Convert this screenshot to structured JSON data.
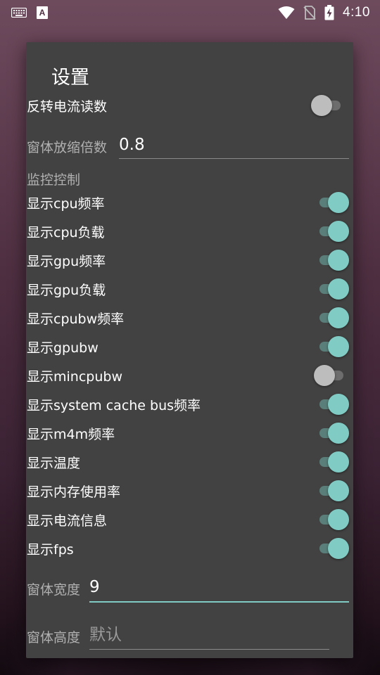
{
  "status_bar": {
    "time": "4:10",
    "left_icons": [
      "keyboard-icon",
      "font-app-icon"
    ],
    "right_icons": [
      "wifi-icon",
      "no-sim-icon",
      "battery-charging-icon"
    ]
  },
  "dialog": {
    "title": "设置",
    "invert_current": {
      "label": "反转电流读数",
      "on": false
    },
    "scale": {
      "label": "窗体放缩倍数",
      "value": "0.8"
    },
    "monitor_header": "监控控制",
    "switches": [
      {
        "label": "显示cpu频率",
        "on": true
      },
      {
        "label": "显示cpu负载",
        "on": true
      },
      {
        "label": "显示gpu频率",
        "on": true
      },
      {
        "label": "显示gpu负载",
        "on": true
      },
      {
        "label": "显示cpubw频率",
        "on": true
      },
      {
        "label": "显示gpubw",
        "on": true
      },
      {
        "label": "显示mincpubw",
        "on": false
      },
      {
        "label": "显示system cache bus频率",
        "on": true
      },
      {
        "label": "显示m4m频率",
        "on": true
      },
      {
        "label": "显示温度",
        "on": true
      },
      {
        "label": "显示内存使用率",
        "on": true
      },
      {
        "label": "显示电流信息",
        "on": true
      },
      {
        "label": "显示fps",
        "on": true
      }
    ],
    "width_field": {
      "label": "窗体宽度",
      "value": "9",
      "focused": true
    },
    "height_field": {
      "label": "窗体高度",
      "placeholder": "默认",
      "value": ""
    }
  },
  "colors": {
    "accent": "#80cbc4",
    "dialog_bg": "#424242",
    "switch_off_thumb": "#bdbdbd"
  }
}
